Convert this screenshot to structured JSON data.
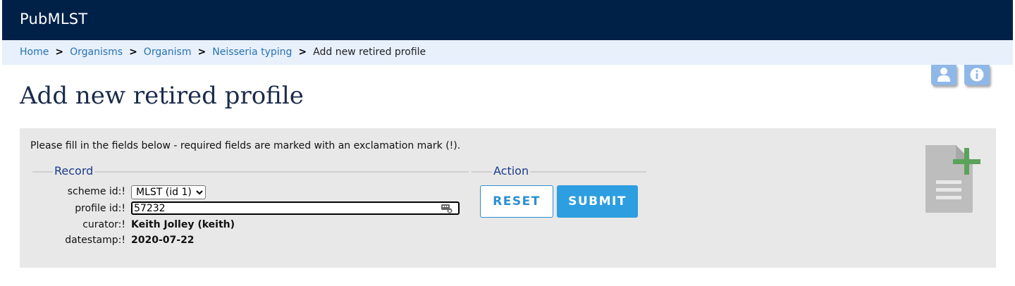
{
  "header": {
    "brand": "PubMLST"
  },
  "breadcrumb": {
    "items": [
      {
        "label": "Home"
      },
      {
        "label": "Organisms"
      },
      {
        "label": "Organism"
      },
      {
        "label": "Neisseria typing"
      }
    ],
    "current": "Add new retired profile",
    "separator": ">"
  },
  "toolbar_icons": {
    "user": "user-icon",
    "info": "info-icon"
  },
  "page": {
    "title": "Add new retired profile"
  },
  "form": {
    "instructions": "Please fill in the fields below - required fields are marked with an exclamation mark (!).",
    "record_legend": "Record",
    "action_legend": "Action",
    "fields": {
      "scheme_label": "scheme id:!",
      "scheme_value": "MLST (id 1)",
      "profile_label": "profile id:!",
      "profile_value": "57232",
      "curator_label": "curator:!",
      "curator_value": "Keith Jolley (keith)",
      "datestamp_label": "datestamp:!",
      "datestamp_value": "2020-07-22"
    },
    "buttons": {
      "reset": "RESET",
      "submit": "SUBMIT"
    }
  },
  "colors": {
    "header_bg": "#002147",
    "breadcrumb_bg": "#e8f0fc",
    "link": "#2673b3",
    "panel_bg": "#e8e8e8",
    "primary_button": "#2d9ee0",
    "icon_button": "#8fb8e8",
    "add_icon_green": "#5aa35a"
  }
}
